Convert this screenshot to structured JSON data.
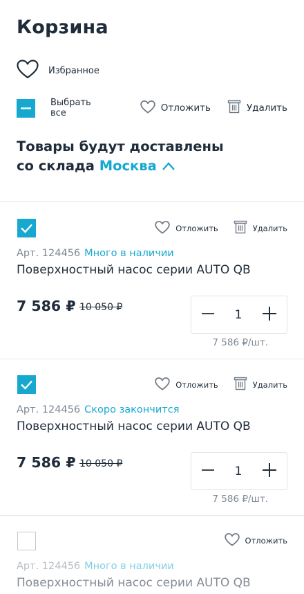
{
  "header": {
    "title": "Корзина"
  },
  "favorites": {
    "label": "Избранное",
    "icon": "heart-icon"
  },
  "toolbar": {
    "select_all_label": "Выбрать все",
    "postpone_label": "Отложить",
    "delete_label": "Удалить"
  },
  "delivery": {
    "line1": "Товары будут доставлены",
    "line2_prefix": "со склада",
    "city": "Москва"
  },
  "items": [
    {
      "checked": true,
      "postpone_label": "Отложить",
      "delete_label": "Удалить",
      "article": "Арт. 124456",
      "stock": "Много в наличии",
      "name": "Поверхностный насос серии AUTO QB",
      "price": "7 586 ₽",
      "old_price": "10 050 ₽",
      "quantity": "1",
      "unit_price": "7 586 ₽/шт."
    },
    {
      "checked": true,
      "postpone_label": "Отложить",
      "delete_label": "Удалить",
      "article": "Арт. 124456",
      "stock": "Скоро закончится",
      "name": "Поверхностный насос серии AUTO QB",
      "price": "7 586 ₽",
      "old_price": "10 050 ₽",
      "quantity": "1",
      "unit_price": "7 586 ₽/шт."
    },
    {
      "checked": false,
      "postpone_label": "Отложить",
      "article": "Арт. 124456",
      "stock": "Много в наличии",
      "name": "Поверхностный насос серии AUTO QB"
    }
  ],
  "colors": {
    "accent": "#17a8cf",
    "text": "#1f2c3a",
    "muted": "#7d8894",
    "divider": "#e5e8eb"
  }
}
